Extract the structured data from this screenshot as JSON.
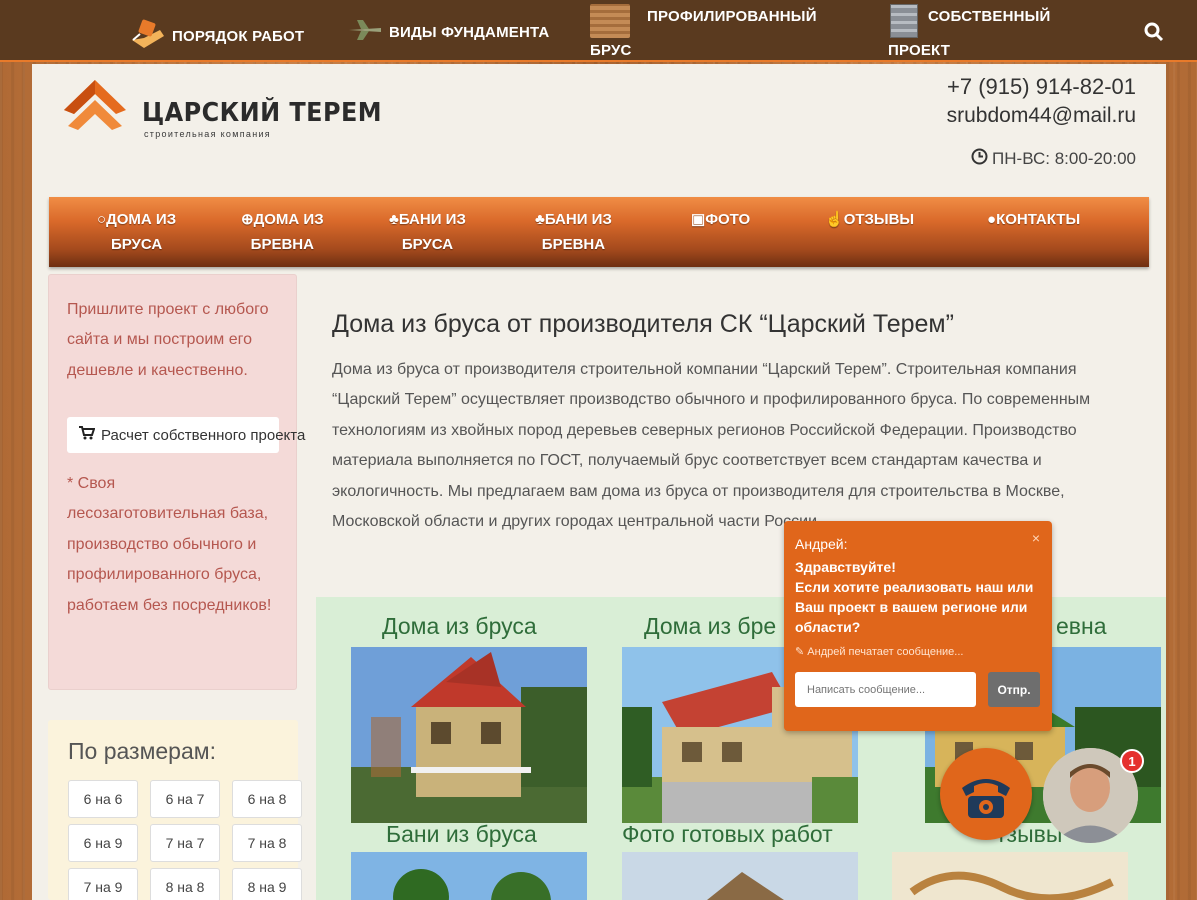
{
  "topnav": {
    "items": [
      {
        "label": "ПОРЯДОК РАБОТ",
        "icon": "money-hand-icon"
      },
      {
        "label": "ВИДЫ ФУНДАМЕНТА",
        "icon": "plane-icon"
      },
      {
        "label_line1": "ПРОФИЛИРОВАННЫЙ",
        "label_line2": "БРУС",
        "icon": "timber-icon"
      },
      {
        "label_line1": "СОБСТВЕННЫЙ",
        "label_line2": "ПРОЕКТ",
        "icon": "building-icon"
      }
    ],
    "search_icon": "search-icon"
  },
  "header": {
    "logo_title": "ЦАРСКИЙ ТЕРЕМ",
    "logo_subtitle": "строительная компания",
    "phone": "+7 (915) 914-82-01",
    "email": "srubdom44@mail.ru",
    "hours": "ПН-ВС: 8:00-20:00"
  },
  "mainnav": {
    "items": [
      {
        "line1": "ДОМА ИЗ",
        "line2": "БРУСА",
        "icon": "house-circle-icon"
      },
      {
        "line1": "ДОМА ИЗ",
        "line2": "БРЕВНА",
        "icon": "plus-circle-icon"
      },
      {
        "line1": "БАНИ ИЗ",
        "line2": "БРУСА",
        "icon": "fire-icon"
      },
      {
        "line1": "БАНИ ИЗ",
        "line2": "БРЕВНА",
        "icon": "fire-icon"
      },
      {
        "line1": "ФОТО",
        "line2": "",
        "icon": "picture-icon"
      },
      {
        "line1": "ОТЗЫВЫ",
        "line2": "",
        "icon": "thumbs-up-icon"
      },
      {
        "line1": "КОНТАКТЫ",
        "line2": "",
        "icon": "user-icon"
      }
    ]
  },
  "sidebar": {
    "promo_text": "Пришлите проект с любого сайта и мы построим его дешевле и качественно.",
    "calc_button": "Расчет собственного проекта",
    "promo_note": "* Своя лесозаготовительная база, производство обычного и профилированного бруса, работаем без посредников!",
    "sizes_title": "По размерам:",
    "sizes": [
      "6 на 6",
      "6 на 7",
      "6 на 8",
      "6 на 9",
      "7 на 7",
      "7 на 8",
      "7 на 9",
      "8 на 8",
      "8 на 9"
    ]
  },
  "article": {
    "title": "Дома из бруса от производителя СК “Царский Терем”",
    "body": "Дома из бруса от производителя строительной компании “Царский Терем”. Строительная компания “Царский Терем” осуществляет производство обычного и профилированного бруса. По современным технологиям из хвойных пород деревьев северных регионов Российской Федерации. Производство материала выполняется по ГОСТ, получаемый брус соответствует всем стандартам качества и экологичность. Мы предлагаем вам дома из бруса от производителя для строительства в Москве, Московской области и других городах центральной части России."
  },
  "catalog": {
    "row1": [
      "Дома из бруса",
      "Дома из бре",
      "евна"
    ],
    "row2": [
      "Бани из бруса",
      "Фото готовых работ",
      "тзывы"
    ]
  },
  "chat": {
    "agent_name": "Андрей:",
    "message_line1": "Здравствуйте!",
    "message_line2": "Если хотите реализовать наш или Ваш проект в вашем регионе или области?",
    "typing": "Андрей печатает сообщение...",
    "input_placeholder": "Написать сообщение...",
    "send_label": "Отпр.",
    "close": "×",
    "badge_count": "1"
  },
  "colors": {
    "topbar": "#5a3a1f",
    "accent": "#e0661b",
    "promo_bg": "#f4dad8",
    "catalog_bg": "#d9eed6"
  }
}
